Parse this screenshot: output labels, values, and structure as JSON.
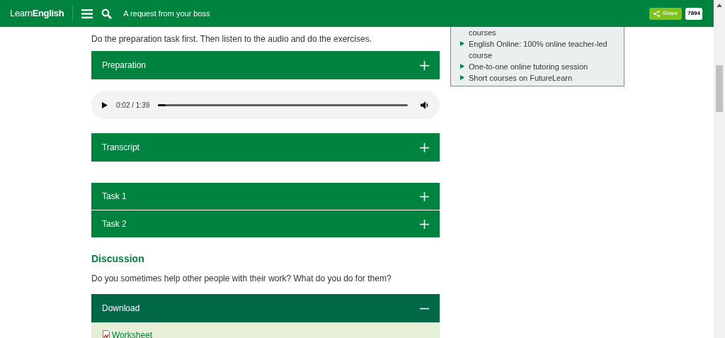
{
  "header": {
    "logo_light": "Learn",
    "logo_bold": "English",
    "page_title": "A request from your boss",
    "share_label": "Share",
    "share_count": "7894"
  },
  "intro": "Do the preparation task first. Then listen to the audio and do the exercises.",
  "sections": [
    {
      "kind": "accordion",
      "title": "Preparation",
      "expanded": false
    },
    {
      "kind": "audio",
      "time": "0:02 / 1:39",
      "level": 0.03
    },
    {
      "kind": "accordion",
      "title": "Transcript",
      "expanded": false
    },
    {
      "kind": "gap"
    },
    {
      "kind": "accordion",
      "title": "Task 1",
      "expanded": false
    },
    {
      "kind": "accordion",
      "title": "Task 2",
      "expanded": false
    }
  ],
  "discussion": {
    "heading": "Discussion",
    "text": "Do you sometimes help other people with their work? What do you do for them?"
  },
  "download": {
    "title": "Download",
    "expanded": true,
    "link": "Worksheet"
  },
  "sidebar": {
    "items": [
      {
        "text": "courses",
        "bullet": false
      },
      {
        "text": "English Online: 100% online teacher-led course",
        "bullet": true
      },
      {
        "text": "One-to-one online tutoring session",
        "bullet": true
      },
      {
        "text": "Short courses on FutureLearn",
        "bullet": true
      }
    ]
  }
}
